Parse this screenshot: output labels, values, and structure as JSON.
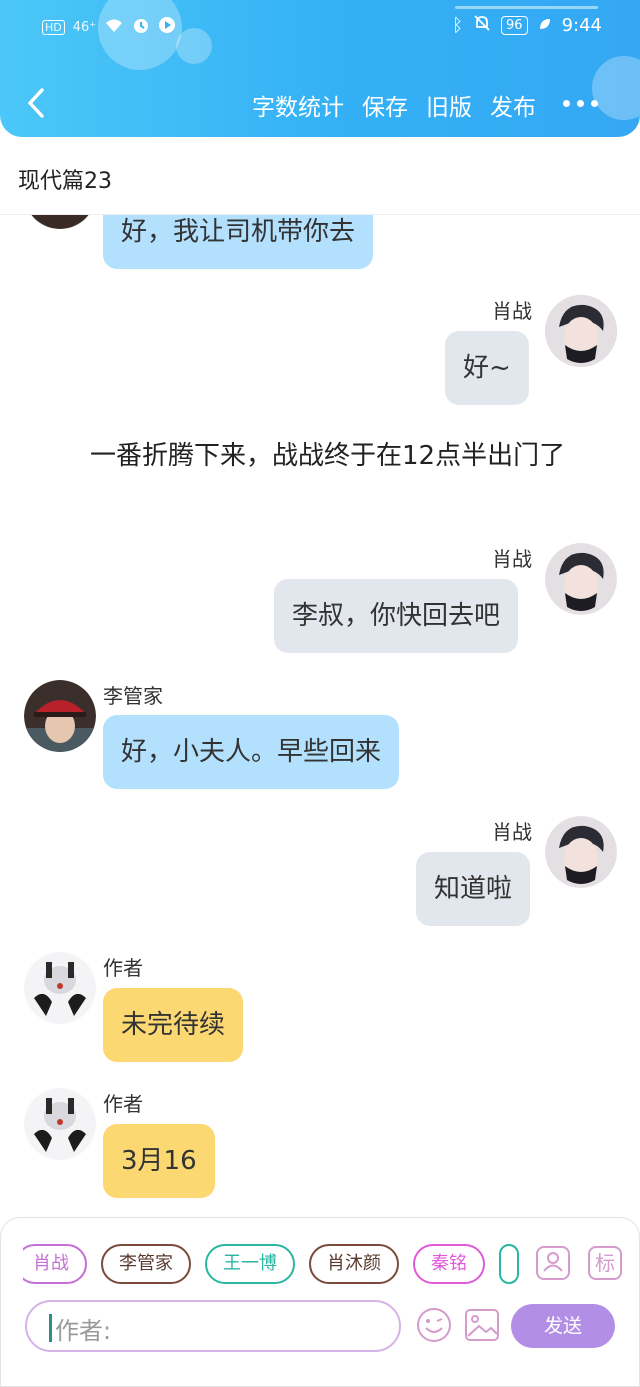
{
  "status_bar": {
    "left_icons": [
      "hd-icon",
      "4g-signal-icon",
      "wifi-icon",
      "alarm-icon",
      "play-icon"
    ],
    "network_label": "HD",
    "network_type": "46⁺",
    "battery": "96",
    "time": "9:44"
  },
  "toolbar": {
    "back_icon": "chevron-left-icon",
    "word_count": "字数统计",
    "save": "保存",
    "old_version": "旧版",
    "publish": "发布",
    "more_icon": "more-dots-icon"
  },
  "title": "现代篇23",
  "messages": [
    {
      "side": "left",
      "name": "",
      "text": "好，我让司机带你去",
      "color": "blue"
    },
    {
      "side": "right",
      "name": "肖战",
      "text": "好~",
      "color": "gray"
    },
    {
      "side": "narration",
      "text": "一番折腾下来，战战终于在12点半出门了"
    },
    {
      "side": "right",
      "name": "肖战",
      "text": "李叔，你快回去吧",
      "color": "gray"
    },
    {
      "side": "left",
      "name": "李管家",
      "text": "好，小夫人。早些回来",
      "color": "blue"
    },
    {
      "side": "right",
      "name": "肖战",
      "text": "知道啦",
      "color": "gray"
    },
    {
      "side": "left",
      "name": "作者",
      "text": "未完待续",
      "color": "yellow"
    },
    {
      "side": "left",
      "name": "作者",
      "text": "3月16",
      "color": "yellow"
    }
  ],
  "characters": [
    {
      "label": "肖战",
      "color": "#c56fd6"
    },
    {
      "label": "李管家",
      "color": "#7b4a3c"
    },
    {
      "label": "王一博",
      "color": "#2bb5a3"
    },
    {
      "label": "肖沐颜",
      "color": "#7b4a3c"
    },
    {
      "label": "秦铭",
      "color": "#e05bd8"
    }
  ],
  "tools": {
    "character_icon": "person-card-icon",
    "tag_label": "标"
  },
  "input": {
    "placeholder": "作者:",
    "value": ""
  },
  "send": "发送",
  "colors": {
    "header": "#33b0f5",
    "bubble_blue": "#b3e0fc",
    "bubble_gray": "#e2e7ee",
    "bubble_yellow": "#fcd873",
    "send_button": "#b38ee7"
  }
}
